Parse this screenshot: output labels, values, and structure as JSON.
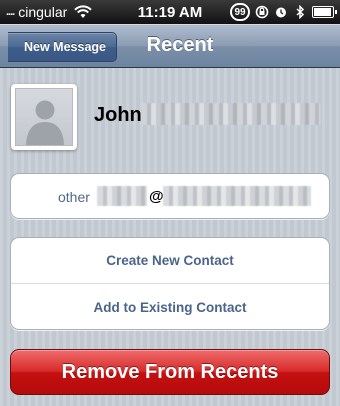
{
  "status_bar": {
    "signal": "....",
    "carrier": "cingular",
    "time": "11:19 AM",
    "badge_count": "99",
    "icons": [
      "wifi-icon",
      "rotation-lock-icon",
      "alarm-icon",
      "bluetooth-icon",
      "battery-icon"
    ]
  },
  "nav": {
    "back_label": "New Message",
    "title": "Recent"
  },
  "contact": {
    "name": "John",
    "avatar_icon": "person-silhouette-icon"
  },
  "email": {
    "label": "other",
    "at": "@"
  },
  "actions": {
    "create_new": "Create New Contact",
    "add_existing": "Add to Existing Contact"
  },
  "remove_label": "Remove From Recents",
  "colors": {
    "nav_blue": "#6d83a1",
    "link_blue": "#4b648b",
    "remove_red": "#c41010",
    "background": "#c5ccd4"
  }
}
